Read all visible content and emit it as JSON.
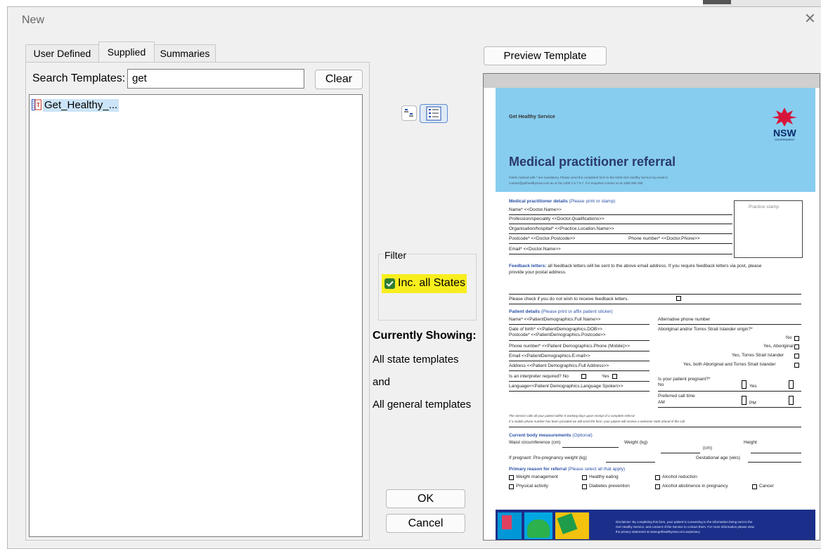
{
  "dialog": {
    "title": "New",
    "close_glyph": "✕"
  },
  "tabs": [
    {
      "label": "User Defined"
    },
    {
      "label": "Supplied"
    },
    {
      "label": "Summaries"
    }
  ],
  "search": {
    "label": "Search Templates:",
    "value": "get",
    "clear_label": "Clear"
  },
  "template_list": [
    {
      "name": "Get_Healthy_...",
      "icon": "template-document-icon"
    }
  ],
  "view_buttons": {
    "small_icons": "small-icons-view-icon",
    "details": "list-view-icon"
  },
  "filter": {
    "label": "Filter",
    "checkbox_label": "Inc. all States",
    "checked": true,
    "highlight_color": "#f8ee1e"
  },
  "currently_showing": {
    "heading": "Currently Showing:",
    "line1": "All state templates",
    "line2": "and",
    "line3": "All general templates"
  },
  "buttons": {
    "ok": "OK",
    "cancel": "Cancel",
    "preview": "Preview Template"
  },
  "preview_doc": {
    "service": "Get Healthy Service",
    "logo_text": "NSW",
    "logo_sub": "GOVERNMENT",
    "title": "Medical practitioner referral",
    "intro1": "Fields marked with * are mandatory. Please send the completed form to the NSW Get Healthy Service by email to",
    "intro2": "contact@gethealthynsw.com.au or fax 1300 2 5 7 6 7. For enquiries contact us at 1300 806 258",
    "sec_practitioner": "Medical practitioner details",
    "sec_practitioner_note": "(Please print or stamp)",
    "practice_stamp": "Practice stamp",
    "f_name": "Name*  <<Doctor.Name>>",
    "f_specialty": "Profession/speciality <<Doctor.Qualifications>>",
    "f_org": "Organisation/hospital*  <<Practice.Location.Name>>",
    "f_postcode": "Postcode*  <<Doctor.Postcode>>",
    "f_phone": "Phone number*  <<Doctor.Phone>>",
    "f_email": "Email*  <<Doctor.Name>>",
    "feedback_title": "Feedback letters:",
    "feedback1": "all feedback letters will be sent to the above email address. If you require feedback letters via post, please",
    "feedback2": "provide your postal address.",
    "feedback_check": "Please check if you do not wish to receive feedback letters.",
    "sec_patient": "Patient details",
    "sec_patient_note": "(Please print or affix patient sticker)",
    "p_name": "Name*  <<PatientDemographics.Full Name>>",
    "p_alt_phone": "Alternative phone number",
    "p_dob": "Date of birth* <<PatientDemographics.DOB>>",
    "p_postcode": "Postcode* <<PatientDemographics.Postcode>>",
    "p_aboriginal": "Aboriginal and/or Torres Strait Islander origin?*",
    "p_no": "No",
    "p_yes_ab": "Yes, Aboriginal",
    "p_yes_ts": "Yes, Torres Strait Islander",
    "p_yes_both": "Yes, both Aboriginal and Torres Strait Islander",
    "p_phone": "Phone number* <<Patient Demographics.Phone (Mobile)>>",
    "p_email": "Email <<PatientDemographics.E-mail>>",
    "p_address": "Address <<Patient Demographics.Full Address>>",
    "p_interpreter": "Is an interpreter required?   No",
    "p_yes": "Yes",
    "p_language": "Language<<Patient Demographics.Language Spoken>>",
    "p_pregnant": "Is your patient pregnant?*",
    "p_no2": "No",
    "p_yes2": "Yes",
    "p_calltime": "Preferred call time",
    "p_am": "AM",
    "p_pm": "PM",
    "consent1": "The Service calls all your patient within 5 working days upon receipt of a complete referral",
    "consent2": "If a mobile phone number has been provided we will send the form; your patient will receive a welcome SMS ahead of the call",
    "sec_body": "Current body measurements",
    "sec_body_note": "(Optional)",
    "waist": "Waist circumference (cm)",
    "weight": "Weight (kg)",
    "height": "Height",
    "cm": "(cm)",
    "preg_weight": "If pregnant: Pre-pregnancy weight (kg)",
    "gest_age": "Gestational age (wks)",
    "sec_reason": "Primary reason for referral",
    "sec_reason_note": "(Please select all that apply)",
    "r_weight": "Weight management",
    "r_eating": "Healthy eating",
    "r_alcohol": "Alcohol reduction",
    "r_activity": "Physical activity",
    "r_diabetes": "Diabetes prevention",
    "r_alc_preg": "Alcohol abstinence in pregnancy",
    "r_cancer": "Cancer",
    "disclaimer1": "Disclaimer: By completing this form, your patient is consenting to the information being sent to the",
    "disclaimer2": "Get Healthy Service, and consent of the Service to contact them. For more information please view",
    "disclaimer3": "the privacy statement at www.gethealthynsw.com.au/privacy"
  }
}
